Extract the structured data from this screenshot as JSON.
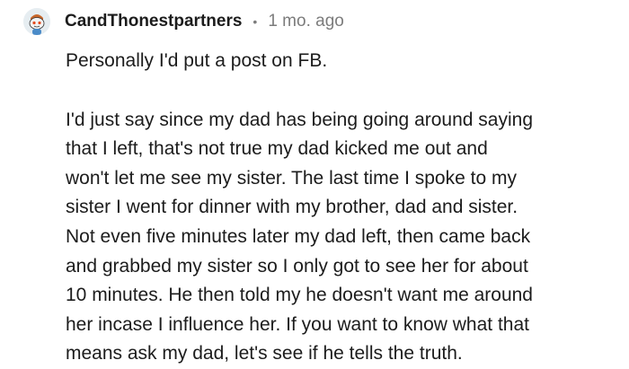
{
  "comment": {
    "username": "CandThonestpartners",
    "separator": "•",
    "timestamp": "1 mo. ago",
    "avatar_icon": "snoo-avatar-icon",
    "paragraph_1": "Personally I'd put a post on FB.",
    "paragraph_2_lines": [
      "I'd just say since my dad has being going around saying",
      "that I left, that's not true my dad kicked me out and",
      "won't let me see my sister. The last time I spoke to my",
      "sister I went for dinner with my brother, dad and sister.",
      "Not even five minutes later my dad left, then came back",
      "and grabbed my sister so I only got to see her for about",
      "10 minutes. He then told my he doesn't want me around",
      "her incase I influence her. If you want to know what that",
      "means ask my dad, let's see if he tells the truth."
    ]
  },
  "colors": {
    "text": "#1c1c1c",
    "meta": "#7c7c7c",
    "background": "#ffffff"
  }
}
